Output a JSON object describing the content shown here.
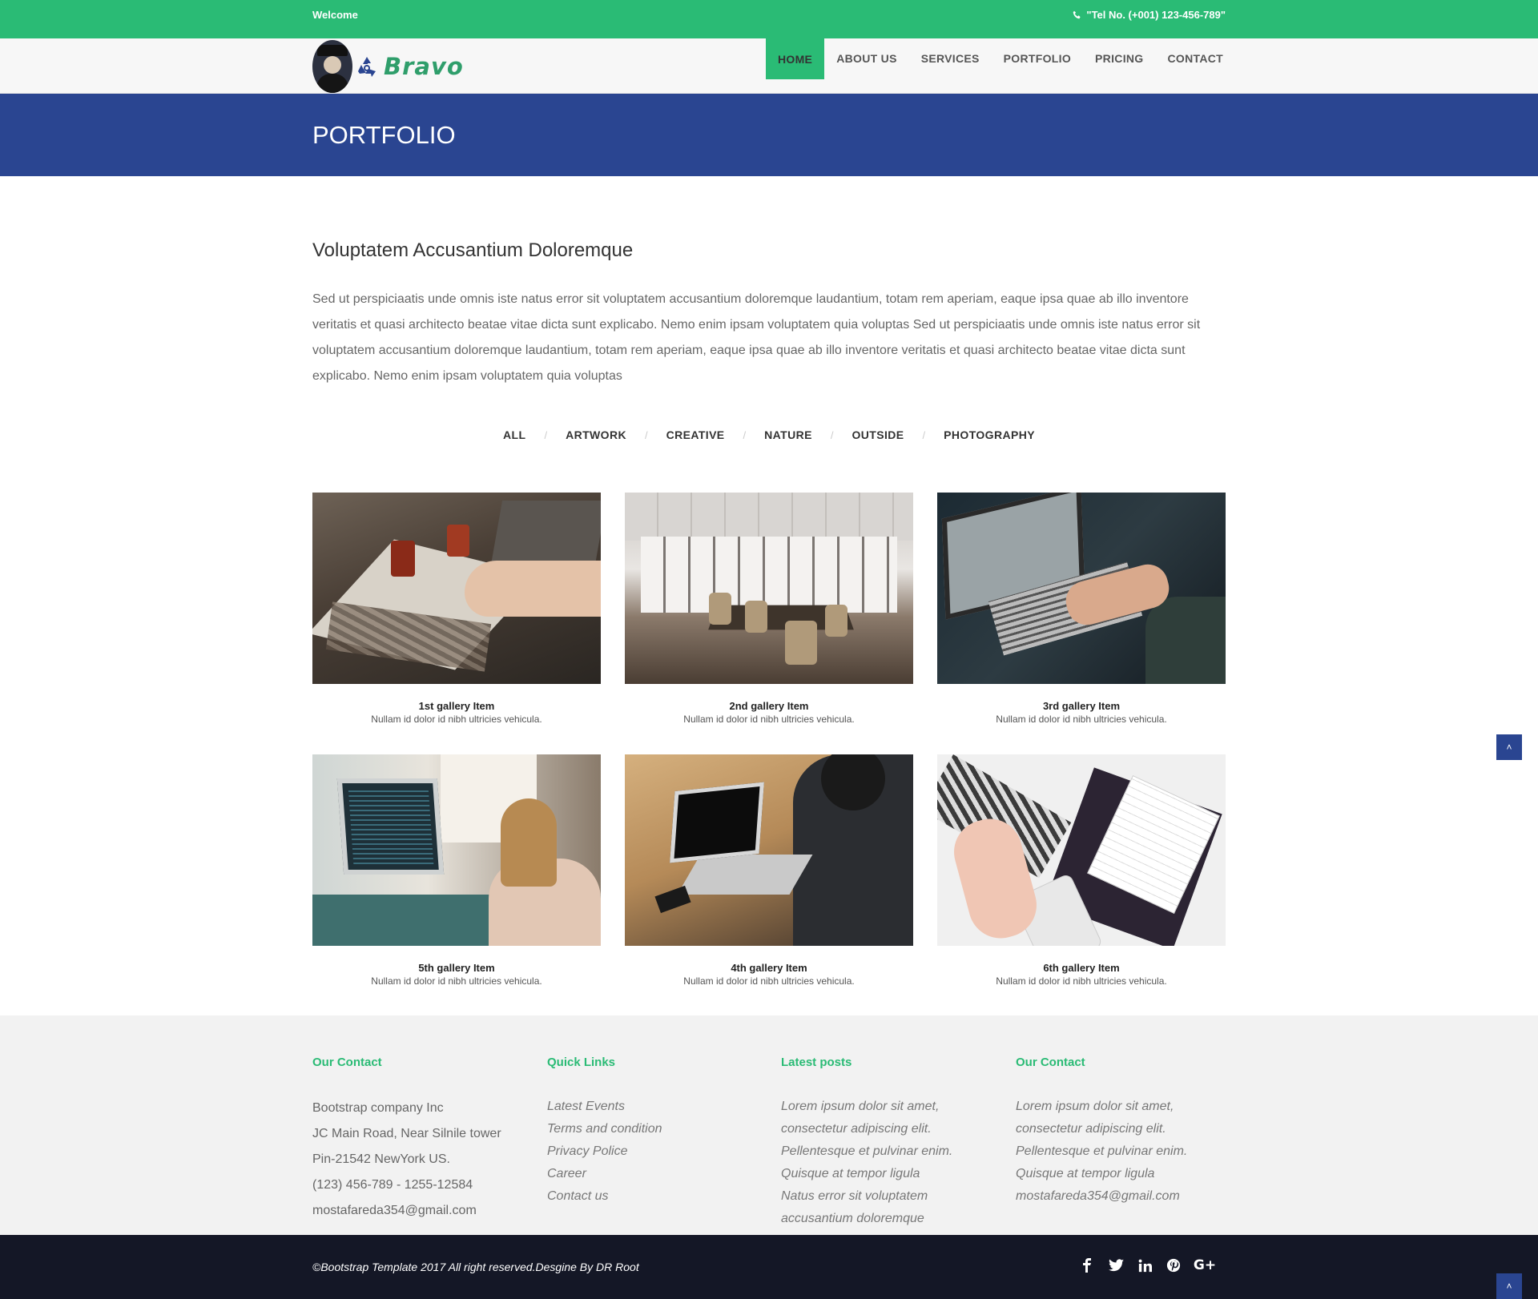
{
  "topbar": {
    "welcome": "Welcome",
    "tel": "\"Tel No. (+001) 123-456-789\""
  },
  "brand": {
    "name": "Bravo"
  },
  "nav": {
    "items": [
      "HOME",
      "ABOUT US",
      "SERVICES",
      "PORTFOLIO",
      "PRICING",
      "CONTACT"
    ],
    "active": "HOME"
  },
  "page_header": {
    "title": "PORTFOLIO"
  },
  "intro": {
    "title": "Voluptatem Accusantium Doloremque",
    "text": "Sed ut perspiciaatis unde omnis iste natus error sit voluptatem accusantium doloremque laudantium, totam rem aperiam, eaque ipsa quae ab illo inventore veritatis et quasi architecto beatae vitae dicta sunt explicabo. Nemo enim ipsam voluptatem quia voluptas Sed ut perspiciaatis unde omnis iste natus error sit voluptatem accusantium doloremque laudantium, totam rem aperiam, eaque ipsa quae ab illo inventore veritatis et quasi architecto beatae vitae dicta sunt explicabo. Nemo enim ipsam voluptatem quia voluptas"
  },
  "filters": [
    "ALL",
    "ARTWORK",
    "CREATIVE",
    "NATURE",
    "OUTSIDE",
    "PHOTOGRAPHY"
  ],
  "gallery": [
    {
      "title": "1st gallery Item",
      "text": "Nullam id dolor id nibh ultricies vehicula."
    },
    {
      "title": "2nd gallery Item",
      "text": "Nullam id dolor id nibh ultricies vehicula."
    },
    {
      "title": "3rd gallery Item",
      "text": "Nullam id dolor id nibh ultricies vehicula."
    },
    {
      "title": "5th gallery Item",
      "text": "Nullam id dolor id nibh ultricies vehicula."
    },
    {
      "title": "4th gallery Item",
      "text": "Nullam id dolor id nibh ultricies vehicula."
    },
    {
      "title": "6th gallery Item",
      "text": "Nullam id dolor id nibh ultricies vehicula."
    }
  ],
  "footer": {
    "contact": {
      "title": "Our Contact",
      "lines": [
        "Bootstrap company Inc",
        "JC Main Road, Near Silnile tower",
        "Pin-21542 NewYork US.",
        "(123) 456-789 - 1255-12584",
        "mostafareda354@gmail.com"
      ]
    },
    "quick_links": {
      "title": "Quick Links",
      "links": [
        "Latest Events",
        "Terms and condition",
        "Privacy Police",
        "Career",
        "Contact us"
      ]
    },
    "latest_posts": {
      "title": "Latest posts",
      "lines": [
        "Lorem ipsum dolor sit amet,",
        "consectetur adipiscing elit.",
        "Pellentesque et pulvinar enim.",
        "Quisque at tempor ligula",
        "Natus error sit voluptatem",
        "accusantium doloremque"
      ]
    },
    "contact2": {
      "title": "Our Contact",
      "lines": [
        "Lorem ipsum dolor sit amet,",
        "consectetur adipiscing elit.",
        "Pellentesque et pulvinar enim.",
        "Quisque at tempor ligula",
        "mostafareda354@gmail.com"
      ]
    }
  },
  "copyright": "©Bootstrap Template 2017 All right reserved.Desgine By DR Root",
  "social": [
    "facebook-icon",
    "twitter-icon",
    "linkedin-icon",
    "pinterest-icon",
    "google-plus-icon"
  ],
  "colors": {
    "green": "#2abb75",
    "blue": "#2a4591",
    "dark": "#141726"
  }
}
